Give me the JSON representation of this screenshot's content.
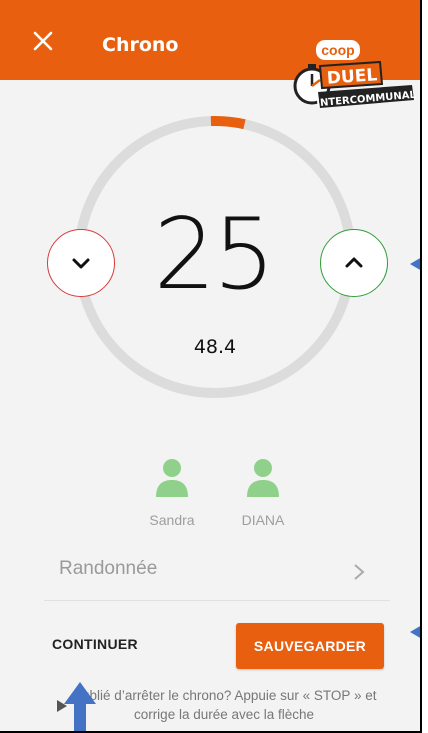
{
  "header": {
    "title": "Chrono",
    "logo": {
      "brand": "coop",
      "line1": "DUEL",
      "line2": "INTERCOMMUNAL"
    }
  },
  "timer": {
    "value": "25",
    "sub_value": "48.4",
    "progress_fraction": 0.03
  },
  "players": [
    {
      "name": "Sandra"
    },
    {
      "name": "DIANA"
    }
  ],
  "activity": {
    "label": "Randonnée"
  },
  "actions": {
    "continue_label": "CONTINUER",
    "save_label": "SAUVEGARDER"
  },
  "hint": {
    "text": "Oublié d’arrêter le chrono? Appuie sur « STOP » et corrige la durée avec la flèche"
  },
  "colors": {
    "brand": "#e8600f",
    "down_border": "#d73b3b",
    "up_border": "#2f9e3a",
    "avatar": "#8fd18a",
    "annotation_arrow": "#4472c4"
  },
  "icons": {
    "close": "close-icon",
    "down": "chevron-down-icon",
    "up": "chevron-up-icon",
    "user": "user-icon",
    "chevron_right": "chevron-right-icon",
    "hint": "play-icon"
  }
}
